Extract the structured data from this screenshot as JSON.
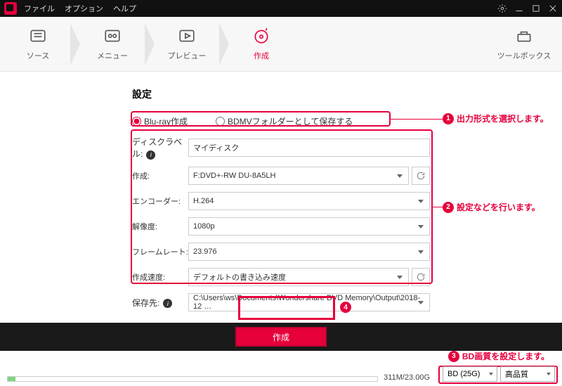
{
  "menu": {
    "file": "ファイル",
    "option": "オプション",
    "help": "ヘルプ"
  },
  "steps": {
    "source": "ソース",
    "menu": "メニュー",
    "preview": "プレビュー",
    "burn": "作成",
    "toolbox": "ツールボックス"
  },
  "panel": {
    "title": "設定",
    "radio1": "Blu-ray作成",
    "radio2": "BDMVフォルダーとして保存する",
    "disc_label": "ディスクラベル:",
    "disc_value": "マイディスク",
    "burn_label": "作成:",
    "burn_value": "F:DVD+-RW DU-8A5LH",
    "encoder_label": "エンコーダー:",
    "encoder_value": "H.264",
    "res_label": "解像度:",
    "res_value": "1080p",
    "fps_label": "フレームレート:",
    "fps_value": "23.976",
    "speed_label": "作成速度:",
    "speed_value": "デフォルトの書き込み速度",
    "save_label": "保存先:",
    "save_value": "C:\\Users\\ws\\Documents\\Wondershare DVD Memory\\Output\\2018-12 …"
  },
  "burn_button": "作成",
  "footer": {
    "size": "311M/23.00G",
    "bd": "BD (25G)",
    "quality": "高品質"
  },
  "ann": {
    "a1": "出力形式を選択します。",
    "a2": "設定などを行います。",
    "a3": "BD画質を設定します。",
    "n4": "4"
  }
}
